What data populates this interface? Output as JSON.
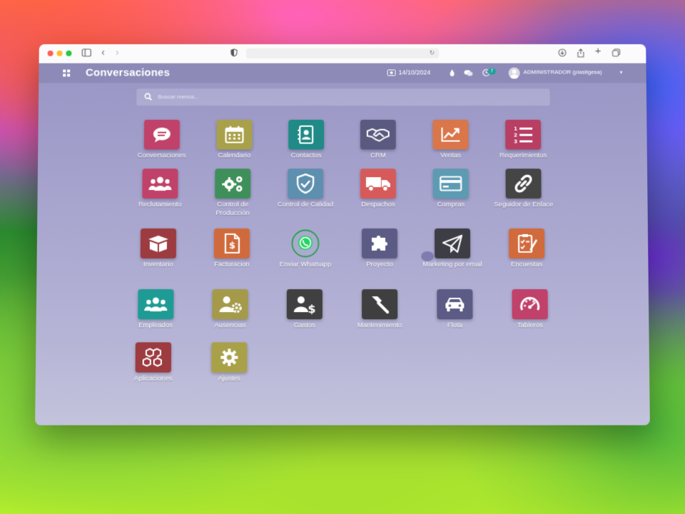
{
  "browser": {
    "traffic_lights": [
      "#ff5f57",
      "#febc2e",
      "#28c840"
    ]
  },
  "navbar": {
    "title": "Conversaciones",
    "date": "14/10/2024",
    "activity_count": "7",
    "user": "ADMINISTRADOR (plastigesa)"
  },
  "search": {
    "placeholder": "Buscar menús..."
  },
  "apps": [
    {
      "label": "Conversaciones",
      "icon": "chat-bubble-icon",
      "color": "#c0416a"
    },
    {
      "label": "Calendario",
      "icon": "calendar-icon",
      "color": "#a9a14a"
    },
    {
      "label": "Contactos",
      "icon": "address-book-icon",
      "color": "#1f8a86"
    },
    {
      "label": "CRM",
      "icon": "handshake-icon",
      "color": "#5a5a80"
    },
    {
      "label": "Ventas",
      "icon": "trend-chart-icon",
      "color": "#d9764a"
    },
    {
      "label": "Requerimientos",
      "icon": "numbered-list-icon",
      "color": "#b83e63"
    },
    {
      "label": "Reclutamiento",
      "icon": "people-icon",
      "color": "#c0416a"
    },
    {
      "label": "Control de Producción",
      "icon": "gears-icon",
      "color": "#3f8f5a"
    },
    {
      "label": "Control de Calidad",
      "icon": "shield-check-icon",
      "color": "#5d8fae"
    },
    {
      "label": "Despachos",
      "icon": "truck-icon",
      "color": "#d65a5a"
    },
    {
      "label": "Compras",
      "icon": "credit-card-icon",
      "color": "#5d9bb3"
    },
    {
      "label": "Seguidor de Enlace",
      "icon": "link-icon",
      "color": "#454545"
    },
    {
      "label": "Inventario",
      "icon": "box-icon",
      "color": "#9c3b40"
    },
    {
      "label": "Facturacion",
      "icon": "invoice-icon",
      "color": "#d06a3c"
    },
    {
      "label": "Enviar Whatsapp",
      "icon": "whatsapp-icon",
      "color": "#25a04a"
    },
    {
      "label": "Proyecto",
      "icon": "puzzle-icon",
      "color": "#5b5b86"
    },
    {
      "label": "Marketing por email",
      "icon": "paper-plane-icon",
      "color": "#3d3d45"
    },
    {
      "label": "Encuestas",
      "icon": "survey-icon",
      "color": "#d16a3c"
    },
    {
      "label": "Empleados",
      "icon": "people-icon",
      "color": "#1f9b95"
    },
    {
      "label": "Ausencias",
      "icon": "user-gear-icon",
      "color": "#a49a49"
    },
    {
      "label": "Gastos",
      "icon": "user-dollar-icon",
      "color": "#404040"
    },
    {
      "label": "Mantenimiento",
      "icon": "hammer-icon",
      "color": "#3f3f3f"
    },
    {
      "label": "Flota",
      "icon": "car-icon",
      "color": "#5b5b86"
    },
    {
      "label": "Tableros",
      "icon": "gauge-icon",
      "color": "#c0416a"
    },
    {
      "label": "Aplicaciones",
      "icon": "cubes-icon",
      "color": "#9c3b40"
    },
    {
      "label": "Ajustes",
      "icon": "gear-icon",
      "color": "#a9a14a"
    }
  ]
}
